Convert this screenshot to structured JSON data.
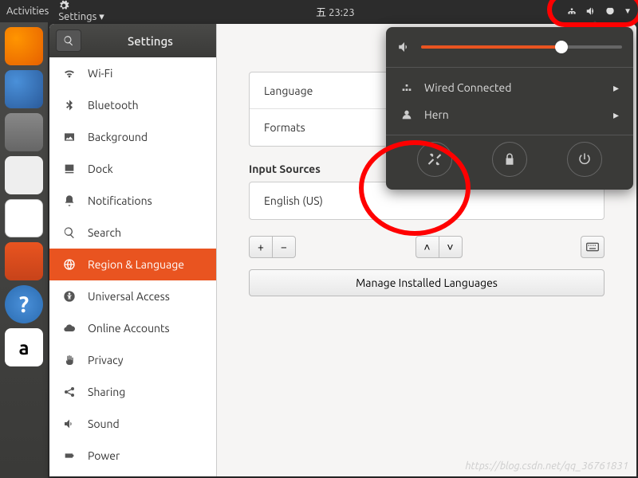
{
  "topbar": {
    "activities": "Activities",
    "app_menu": "Settings ▾",
    "clock": "五 23:23"
  },
  "sidebar": {
    "title": "Settings",
    "items": [
      {
        "label": "Wi-Fi"
      },
      {
        "label": "Bluetooth"
      },
      {
        "label": "Background"
      },
      {
        "label": "Dock"
      },
      {
        "label": "Notifications"
      },
      {
        "label": "Search"
      },
      {
        "label": "Region & Language"
      },
      {
        "label": "Universal Access"
      },
      {
        "label": "Online Accounts"
      },
      {
        "label": "Privacy"
      },
      {
        "label": "Sharing"
      },
      {
        "label": "Sound"
      },
      {
        "label": "Power"
      }
    ]
  },
  "main": {
    "language_label": "Language",
    "formats_label": "Formats",
    "input_sources_title": "Input Sources",
    "input_source_0": "English (US)",
    "manage_button": "Manage Installed Languages"
  },
  "system_menu": {
    "wired": "Wired Connected",
    "user": "Hern"
  },
  "watermark": "https://blog.csdn.net/qq_36761831"
}
